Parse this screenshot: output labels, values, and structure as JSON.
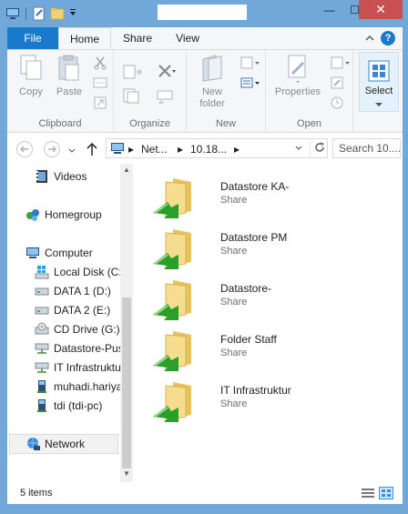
{
  "title_bar": {
    "window_title": "",
    "minimize_symbol": "—",
    "maximize_symbol": "☐",
    "close_symbol": "✕"
  },
  "tabs": {
    "file": "File",
    "home": "Home",
    "share": "Share",
    "view": "View",
    "help": "?"
  },
  "ribbon": {
    "clipboard": {
      "label": "Clipboard",
      "copy": "Copy",
      "paste": "Paste"
    },
    "organize": {
      "label": "Organize"
    },
    "new": {
      "label": "New",
      "new_folder_line1": "New",
      "new_folder_line2": "folder"
    },
    "open": {
      "label": "Open",
      "properties": "Properties"
    },
    "select": {
      "label": "Select"
    }
  },
  "address_bar": {
    "crumb_1": "Net...",
    "crumb_2": "10.18...",
    "search_placeholder": "Search 10...."
  },
  "nav_pane": {
    "items": [
      {
        "label": "Videos",
        "icon": "video-folder-icon"
      },
      {
        "label": "Homegroup",
        "icon": "homegroup-icon"
      },
      {
        "label": "Computer",
        "icon": "computer-icon"
      },
      {
        "label": "Local Disk (C:)",
        "icon": "windows-drive-icon"
      },
      {
        "label": "DATA 1 (D:)",
        "icon": "drive-icon"
      },
      {
        "label": "DATA 2 (E:)",
        "icon": "drive-icon"
      },
      {
        "label": "CD Drive (G:)",
        "icon": "cd-drive-icon"
      },
      {
        "label": "Datastore-Pus",
        "icon": "network-drive-icon"
      },
      {
        "label": "IT Infrastruktur",
        "icon": "network-drive-icon"
      },
      {
        "label": "muhadi.hariya",
        "icon": "network-computer-icon"
      },
      {
        "label": "tdi (tdi-pc)",
        "icon": "network-computer-icon"
      },
      {
        "label": "Network",
        "icon": "network-icon"
      }
    ]
  },
  "content": {
    "items": [
      {
        "name": "Datastore KA-",
        "type": "Share"
      },
      {
        "name": "Datastore PM",
        "type": "Share"
      },
      {
        "name": "Datastore-",
        "type": "Share"
      },
      {
        "name": "Folder Staff",
        "type": "Share"
      },
      {
        "name": "IT Infrastruktur",
        "type": "Share"
      }
    ]
  },
  "status_bar": {
    "item_count": "5 items"
  },
  "colors": {
    "titlebar": "#6fa8d9",
    "file_tab": "#1979ca",
    "close_button": "#c75050",
    "folder": "#f0d27a",
    "share_arrow": "#2aa02a"
  }
}
